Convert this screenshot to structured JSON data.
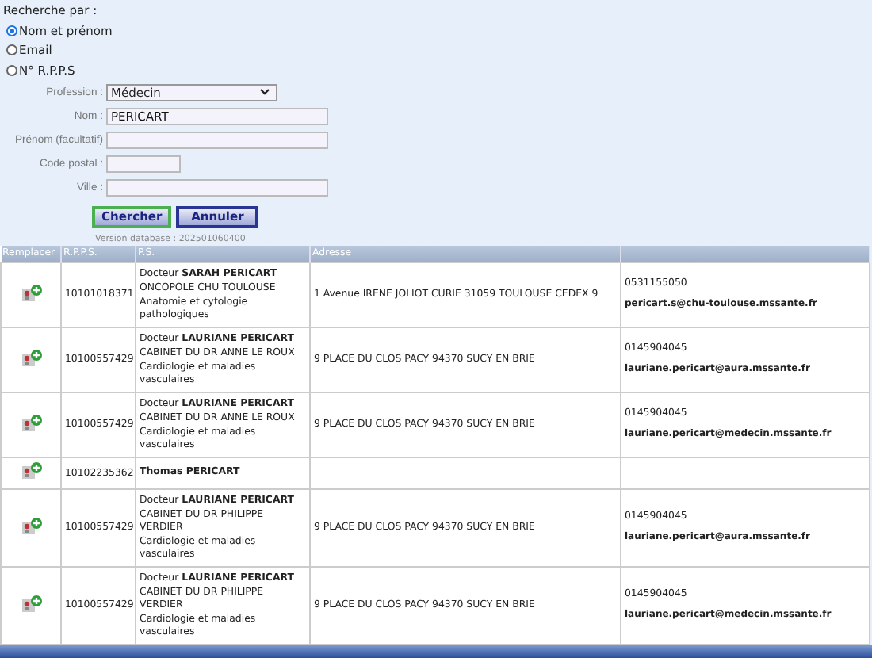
{
  "search": {
    "title": "Recherche par :",
    "radios": [
      {
        "label": "Nom et prénom",
        "selected": true
      },
      {
        "label": "Email",
        "selected": false
      },
      {
        "label": "N° R.P.P.S",
        "selected": false
      }
    ],
    "fields": [
      {
        "label": "Profession :",
        "kind": "select",
        "value": "Médecin"
      },
      {
        "label": "Nom :",
        "kind": "text",
        "value": "PERICART"
      },
      {
        "label": "Prénom (facultatif)",
        "kind": "text"
      },
      {
        "label": "Code postal :",
        "kind": "short"
      },
      {
        "label": "Ville :",
        "kind": "text"
      }
    ],
    "buttons": [
      {
        "label": "Chercher",
        "selected": true
      },
      {
        "label": "Annuler",
        "selected": false
      }
    ],
    "version": "Version database : 202501060400"
  },
  "table": {
    "columns": [
      "Remplacer",
      "R.P.P.S.",
      "P.S.",
      "Adresse"
    ],
    "rows": [
      {
        "rpps": "10101018371",
        "title": "Docteur",
        "name": "SARAH PERICART",
        "org": "ONCOPOLE CHU TOULOUSE",
        "specialty": "Anatomie et cytologie pathologiques",
        "address": "1 Avenue IRENE JOLIOT CURIE 31059 TOULOUSE CEDEX 9",
        "phone": "0531155050",
        "email": "pericart.s@chu-toulouse.mssante.fr"
      },
      {
        "rpps": "10100557429",
        "title": "Docteur",
        "name": "LAURIANE PERICART",
        "org": "CABINET DU DR ANNE LE ROUX",
        "specialty": "Cardiologie et maladies vasculaires",
        "address": "9 PLACE DU CLOS PACY 94370 SUCY EN BRIE",
        "phone": "0145904045",
        "email": "lauriane.pericart@aura.mssante.fr"
      },
      {
        "rpps": "10100557429",
        "title": "Docteur",
        "name": "LAURIANE PERICART",
        "org": "CABINET DU DR ANNE LE ROUX",
        "specialty": "Cardiologie et maladies vasculaires",
        "address": "9 PLACE DU CLOS PACY 94370 SUCY EN BRIE",
        "phone": "0145904045",
        "email": "lauriane.pericart@medecin.mssante.fr"
      },
      {
        "rpps": "10102235362",
        "name": "Thomas PERICART"
      },
      {
        "rpps": "10100557429",
        "title": "Docteur",
        "name": "LAURIANE PERICART",
        "org": "CABINET DU DR PHILIPPE VERDIER",
        "specialty": "Cardiologie et maladies vasculaires",
        "address": "9 PLACE DU CLOS PACY 94370 SUCY EN BRIE",
        "phone": "0145904045",
        "email": "lauriane.pericart@aura.mssante.fr"
      },
      {
        "rpps": "10100557429",
        "title": "Docteur",
        "name": "LAURIANE PERICART",
        "org": "CABINET DU DR PHILIPPE VERDIER",
        "specialty": "Cardiologie et maladies vasculaires",
        "address": "9 PLACE DU CLOS PACY 94370 SUCY EN BRIE",
        "phone": "0145904045",
        "email": "lauriane.pericart@medecin.mssante.fr"
      }
    ]
  }
}
